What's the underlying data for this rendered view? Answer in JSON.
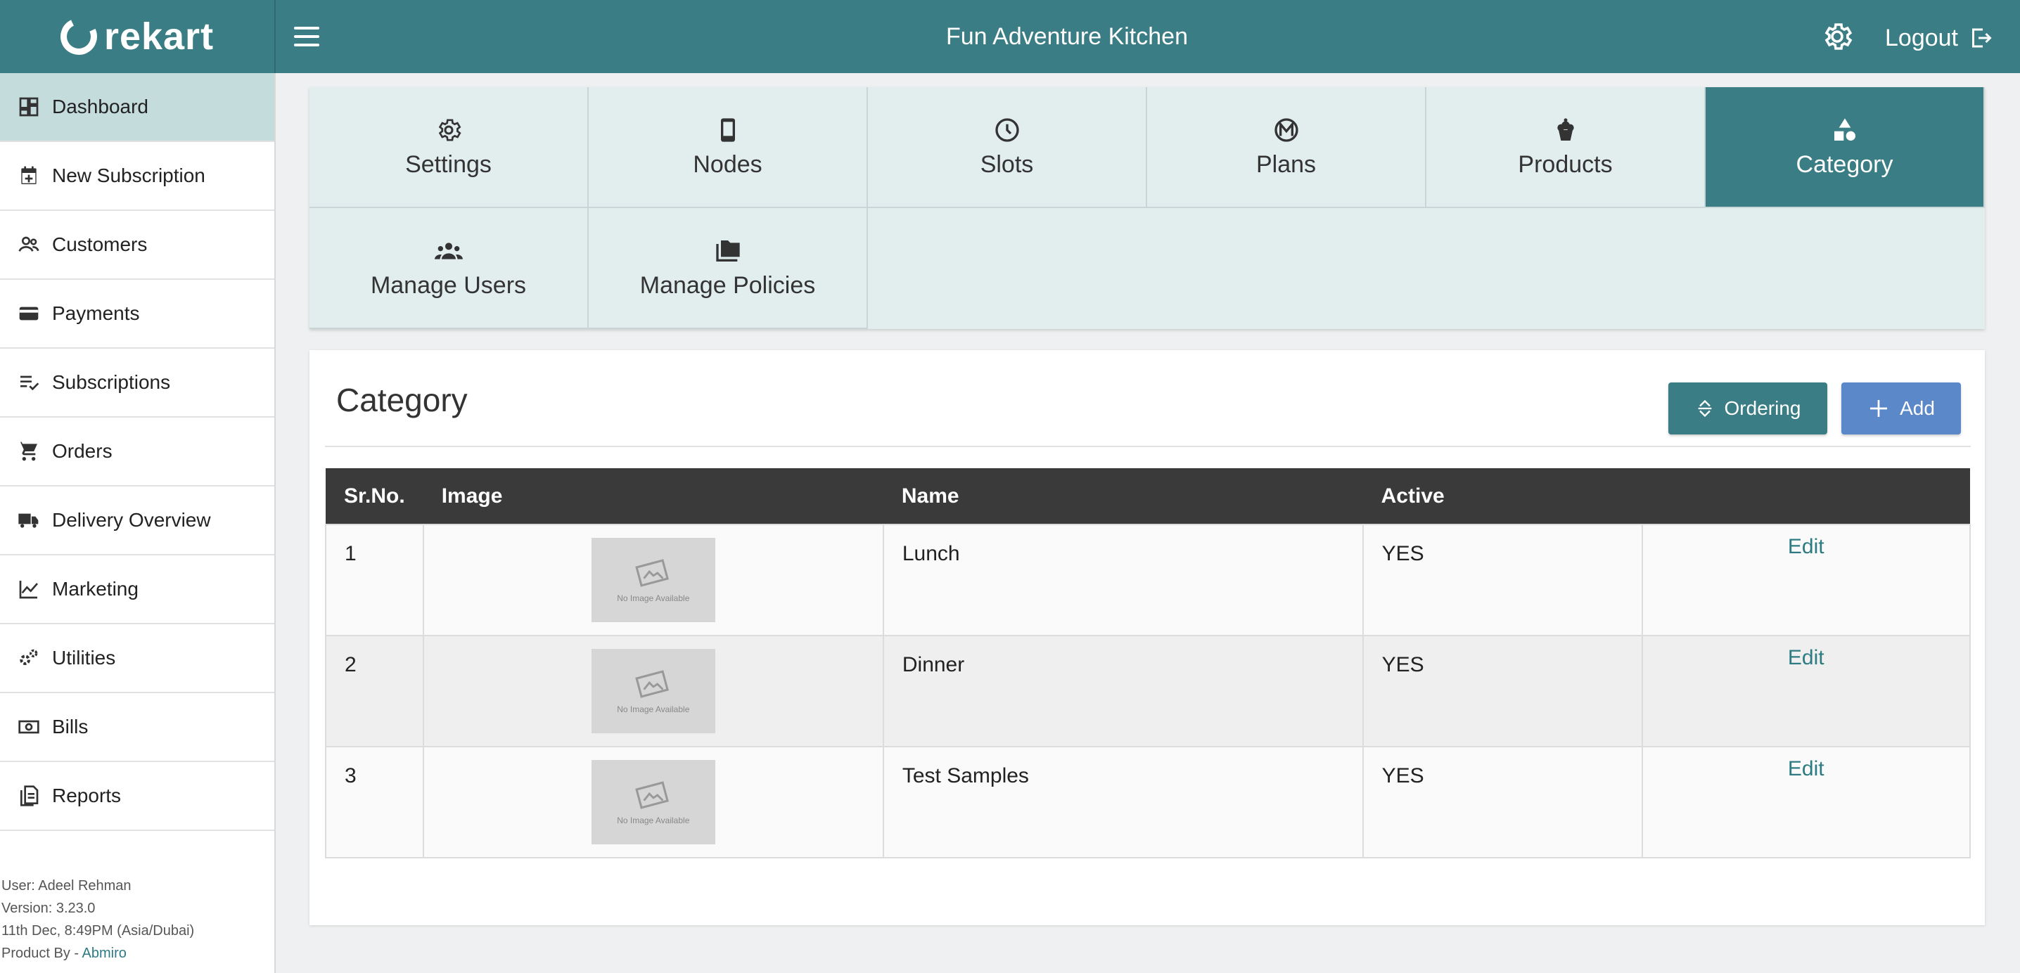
{
  "brand": {
    "logo_text": "rekart"
  },
  "header": {
    "title": "Fun Adventure Kitchen",
    "logout_label": "Logout"
  },
  "sidebar": {
    "items": [
      {
        "label": "Dashboard",
        "icon": "dashboard-icon",
        "active": true
      },
      {
        "label": "New Subscription",
        "icon": "calendar-add-icon"
      },
      {
        "label": "Customers",
        "icon": "people-icon"
      },
      {
        "label": "Payments",
        "icon": "credit-card-icon"
      },
      {
        "label": "Subscriptions",
        "icon": "playlist-check-icon"
      },
      {
        "label": "Orders",
        "icon": "cart-icon"
      },
      {
        "label": "Delivery Overview",
        "icon": "truck-icon"
      },
      {
        "label": "Marketing",
        "icon": "chart-line-icon"
      },
      {
        "label": "Utilities",
        "icon": "gears-icon"
      },
      {
        "label": "Bills",
        "icon": "bill-icon"
      },
      {
        "label": "Reports",
        "icon": "document-icon"
      }
    ],
    "footer": {
      "user": "User: Adeel Rehman",
      "version": "Version: 3.23.0",
      "datetime": "11th Dec, 8:49PM (Asia/Dubai)",
      "product_by": "Product By - ",
      "company": "Abmiro"
    }
  },
  "tabs": [
    {
      "label": "Settings",
      "icon": "gear-icon"
    },
    {
      "label": "Nodes",
      "icon": "phone-icon"
    },
    {
      "label": "Slots",
      "icon": "clock-icon"
    },
    {
      "label": "Plans",
      "icon": "plan-badge-icon"
    },
    {
      "label": "Products",
      "icon": "cupcake-icon"
    },
    {
      "label": "Category",
      "icon": "shapes-icon",
      "active": true
    },
    {
      "label": "Manage Users",
      "icon": "group-icon"
    },
    {
      "label": "Manage Policies",
      "icon": "folders-icon"
    }
  ],
  "category": {
    "title": "Category",
    "ordering_label": "Ordering",
    "add_label": "Add",
    "columns": [
      "Sr.No.",
      "Image",
      "Name",
      "Active",
      ""
    ],
    "rows": [
      {
        "srno": "1",
        "image_text": "No Image Available",
        "name": "Lunch",
        "active": "YES",
        "action": "Edit"
      },
      {
        "srno": "2",
        "image_text": "No Image Available",
        "name": "Dinner",
        "active": "YES",
        "action": "Edit"
      },
      {
        "srno": "3",
        "image_text": "No Image Available",
        "name": "Test Samples",
        "active": "YES",
        "action": "Edit"
      }
    ]
  },
  "colors": {
    "primary": "#3b7d84",
    "accent_blue": "#5b88c9",
    "table_header": "#3a3a3a"
  }
}
